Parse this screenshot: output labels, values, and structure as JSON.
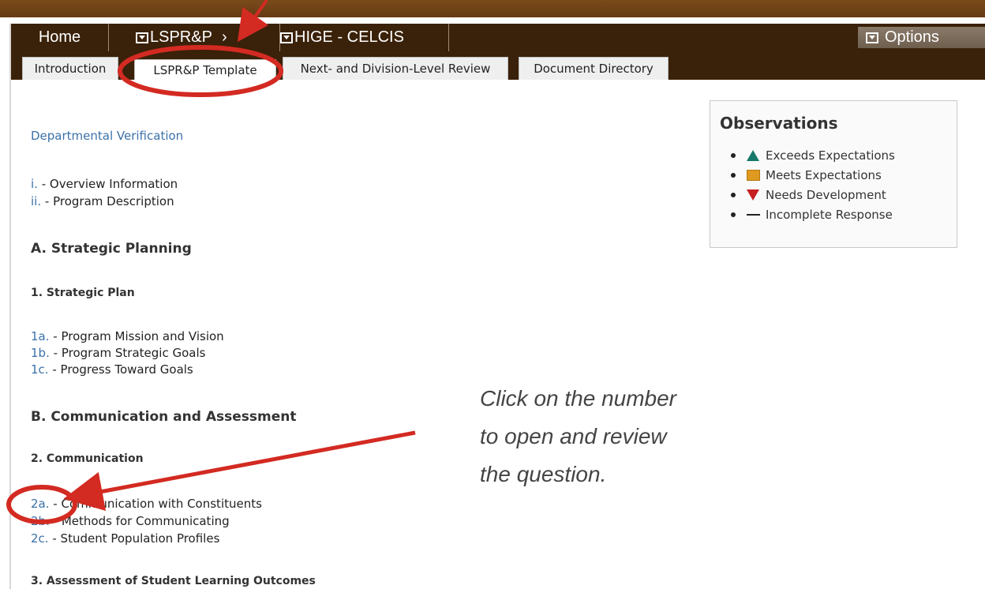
{
  "nav": {
    "home": "Home",
    "lspr": "LSPR&P",
    "separator": "›",
    "hige": "HIGE - CELCIS",
    "options": "Options"
  },
  "tabs": [
    {
      "label": "Introduction",
      "active": false
    },
    {
      "label": "LSPR&P Template",
      "active": true
    },
    {
      "label": "Next- and Division-Level Review",
      "active": false
    },
    {
      "label": "Document Directory",
      "active": false
    }
  ],
  "main": {
    "departmental_verification": "Departmental Verification",
    "overview": [
      {
        "num": "i.",
        "title": "Overview Information"
      },
      {
        "num": "ii.",
        "title": "Program Description"
      }
    ],
    "section_a": {
      "heading": "A. Strategic Planning",
      "sub": "1. Strategic Plan",
      "items": [
        {
          "num": "1a.",
          "title": "Program Mission and Vision"
        },
        {
          "num": "1b.",
          "title": "Program Strategic Goals"
        },
        {
          "num": "1c.",
          "title": "Progress Toward Goals"
        }
      ]
    },
    "section_b": {
      "heading": "B. Communication and Assessment",
      "sub": "2. Communication",
      "items": [
        {
          "num": "2a.",
          "title": "Communication with Constituents"
        },
        {
          "num": "2b.",
          "title": "Methods for Communicating"
        },
        {
          "num": "2c.",
          "title": "Student Population Profiles"
        }
      ],
      "sub3": "3. Assessment of Student Learning Outcomes"
    },
    "dash": "-"
  },
  "observations": {
    "title": "Observations",
    "items": [
      {
        "icon": "triangle-up-icon",
        "label": "Exceeds Expectations",
        "color": "#17796b"
      },
      {
        "icon": "square-icon",
        "label": "Meets Expectations",
        "color": "#e09a1f"
      },
      {
        "icon": "triangle-down-icon",
        "label": "Needs Development",
        "color": "#c62020"
      },
      {
        "icon": "dash-icon",
        "label": "Incomplete Response",
        "color": "#222222"
      }
    ]
  },
  "callout": {
    "lines": [
      "Click on the number",
      "to open and review",
      "the question."
    ]
  },
  "annotation_color": "#d32a22"
}
